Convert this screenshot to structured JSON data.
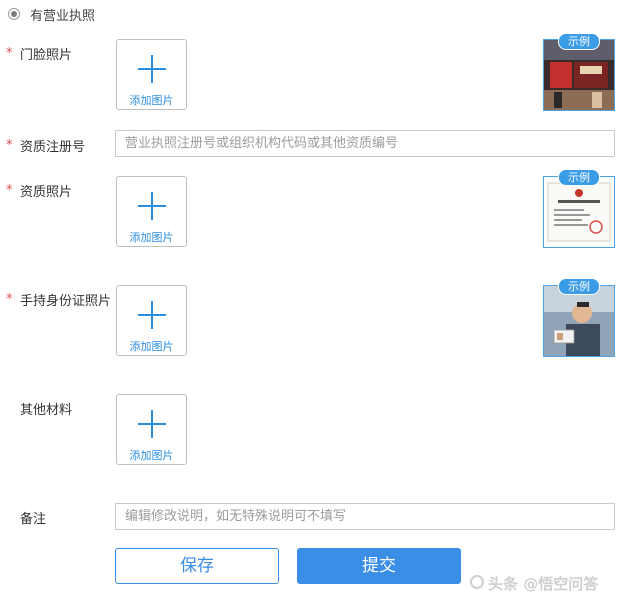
{
  "radio": {
    "label": "有营业执照"
  },
  "fields": {
    "store_photo": {
      "required": "*",
      "label": "门脸照片"
    },
    "reg_number": {
      "required": "*",
      "label": "资质注册号",
      "placeholder": "营业执照注册号或组织机构代码或其他资质编号"
    },
    "qual_photo": {
      "required": "*",
      "label": "资质照片"
    },
    "id_photo": {
      "required": "*",
      "label": "手持身份证照片"
    },
    "other": {
      "label": "其他材料"
    },
    "remark": {
      "label": "备注",
      "placeholder": "编辑修改说明，如无特殊说明可不填写"
    }
  },
  "upload_caption": "添加图片",
  "example_tag": "示例",
  "buttons": {
    "save": "保存",
    "submit": "提交"
  },
  "watermark": "头条 @悟空问答",
  "colors": {
    "accent": "#3a8ee6",
    "required": "#e64d4d"
  }
}
